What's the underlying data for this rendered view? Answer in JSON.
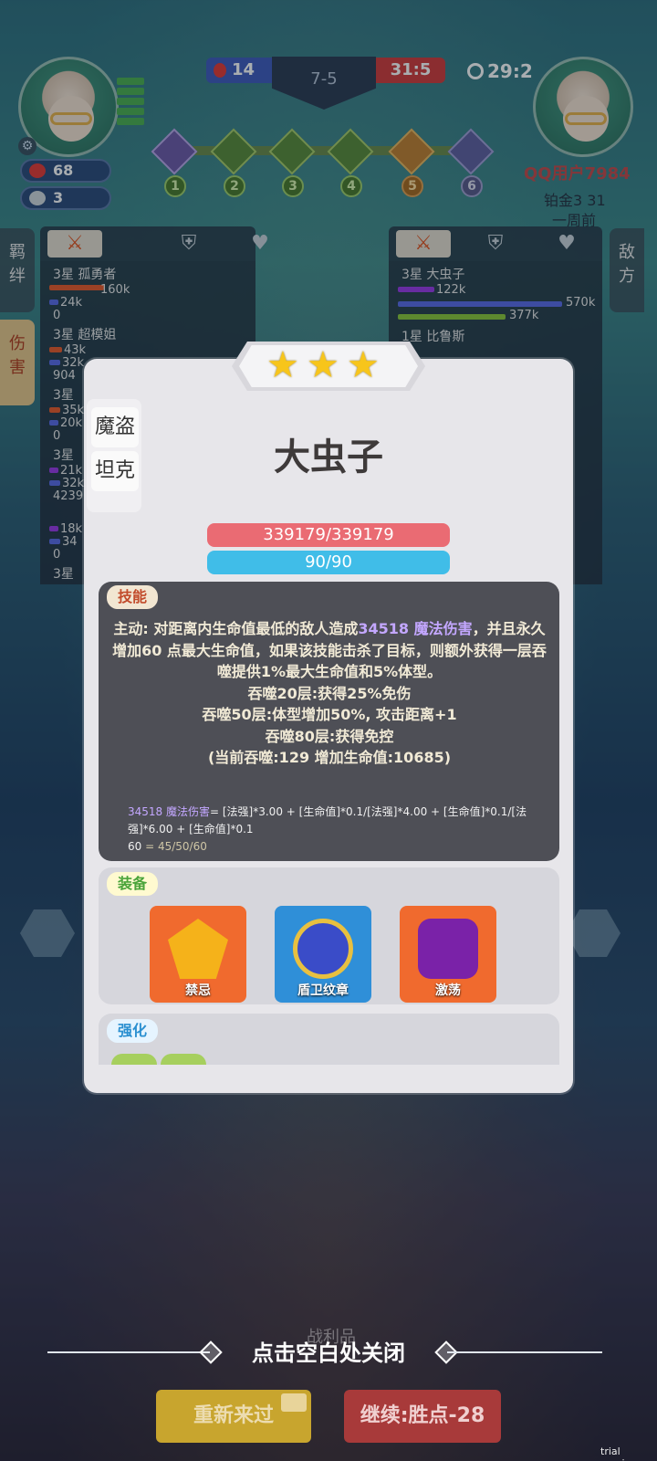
{
  "hud": {
    "score_left": "14",
    "round": "7-5",
    "score_right": "31:5",
    "timer": "29:2",
    "hearts": "68",
    "coins": "3",
    "stages": [
      "1",
      "2",
      "3",
      "4",
      "5",
      "6"
    ],
    "opponent_name": "QQ用户7984",
    "opponent_rank": "铂金3 31",
    "opponent_time": "一周前"
  },
  "left_panel": {
    "tabs": [
      "羁\n绊",
      "伤\n害"
    ],
    "rows": [
      {
        "name": "3星 孤勇者",
        "vals": [
          "160k",
          "24k",
          "0"
        ]
      },
      {
        "name": "3星 超模姐",
        "vals": [
          "43k",
          "32k",
          "904"
        ]
      },
      {
        "name": "3星",
        "vals": [
          "35k",
          "20k",
          "0"
        ]
      },
      {
        "name": "3星",
        "vals": [
          "21k",
          "32k",
          "4239"
        ]
      },
      {
        "name": "",
        "vals": [
          "18k",
          "34",
          "0"
        ]
      },
      {
        "name": "3星",
        "vals": []
      }
    ]
  },
  "right_panel": {
    "tab": "敌\n方",
    "rows": [
      {
        "name": "3星 大虫子",
        "vals": [
          "122k",
          "570k",
          "377k"
        ]
      },
      {
        "name": "1星 比鲁斯",
        "vals": []
      }
    ]
  },
  "card": {
    "traits": [
      "魔盗",
      "坦克"
    ],
    "unit_name": "大虫子",
    "hp": "339179/339179",
    "mp": "90/90",
    "skill_label": "技能",
    "skill_lines": {
      "p1": "主动: 对距离内生命值最低的敌人造成",
      "dmg": "34518 魔法伤害",
      "p2": "，并且永久增加",
      "hpadd": "60",
      "p3": " 点最大生命值，如果该技能击杀了目标，则额外获得一层吞噬提供1%最大生命值和5%体型。",
      "l2": "吞噬20层:获得25%免伤",
      "l3": "吞噬50层:体型增加50%, 攻击距离+1",
      "l4": "吞噬80层:获得免控",
      "l5": "(当前吞噬:129 增加生命值:10685)"
    },
    "formula_head": "34518 魔法伤害",
    "formula_body": "= [法强]*3.00 + [生命值]*0.1/[法强]*4.00 + [生命值]*0.1/[法强]*6.00 + [生命值]*0.1",
    "formula_tail_a": "60",
    "formula_tail_b": " = 45/50/60",
    "equip_label": "装备",
    "equipment": [
      {
        "name": "禁忌",
        "color": "#f06a2e",
        "gem": "#f5b21a"
      },
      {
        "name": "盾卫纹章",
        "color": "#2f8fd8",
        "gem": "#3a4cc8"
      },
      {
        "name": "激荡",
        "color": "#f06a2e",
        "gem": "#7a22a8"
      }
    ],
    "enh_label": "强化"
  },
  "bottom": {
    "close_hint": "点击空白处关闭",
    "loot": "战利品",
    "retry": "重新来过",
    "continue": "继续:胜点-28",
    "trial": "trial version"
  }
}
